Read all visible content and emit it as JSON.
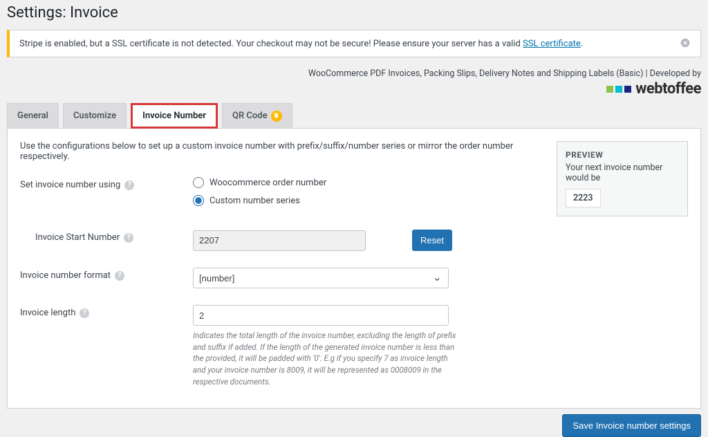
{
  "header": {
    "title": "Settings: Invoice"
  },
  "notice": {
    "text_before": "Stripe is enabled, but a SSL certificate is not detected. Your checkout may not be secure! Please ensure your server has a valid ",
    "link_text": "SSL certificate",
    "text_after": "."
  },
  "dev_line": "WooCommerce PDF Invoices, Packing Slips, Delivery Notes and Shipping Labels (Basic) | Developed by",
  "brand": "webtoffee",
  "tabs": [
    {
      "label": "General"
    },
    {
      "label": "Customize"
    },
    {
      "label": "Invoice Number"
    },
    {
      "label": "QR Code"
    }
  ],
  "intro": "Use the configurations below to set up a custom invoice number with prefix/suffix/number series or mirror the order number respectively.",
  "fields": {
    "set_using": {
      "label": "Set invoice number using",
      "opt1": "Woocommerce order number",
      "opt2": "Custom number series"
    },
    "start_number": {
      "label": "Invoice Start Number",
      "value": "2207",
      "reset": "Reset"
    },
    "format": {
      "label": "Invoice number format",
      "value": "[number]"
    },
    "length": {
      "label": "Invoice length",
      "value": "2",
      "help": "Indicates the total length of the invoice number, excluding the length of prefix and suffix if added. If the length of the generated invoice number is less than the provided, it will be padded with '0'. E.g if you specify 7 as invoice length and your invoice number is 8009, it will be represented as 0008009 in the respective documents."
    }
  },
  "preview": {
    "title": "PREVIEW",
    "desc": "Your next invoice number would be",
    "value": "2223"
  },
  "save_button": "Save Invoice number settings"
}
